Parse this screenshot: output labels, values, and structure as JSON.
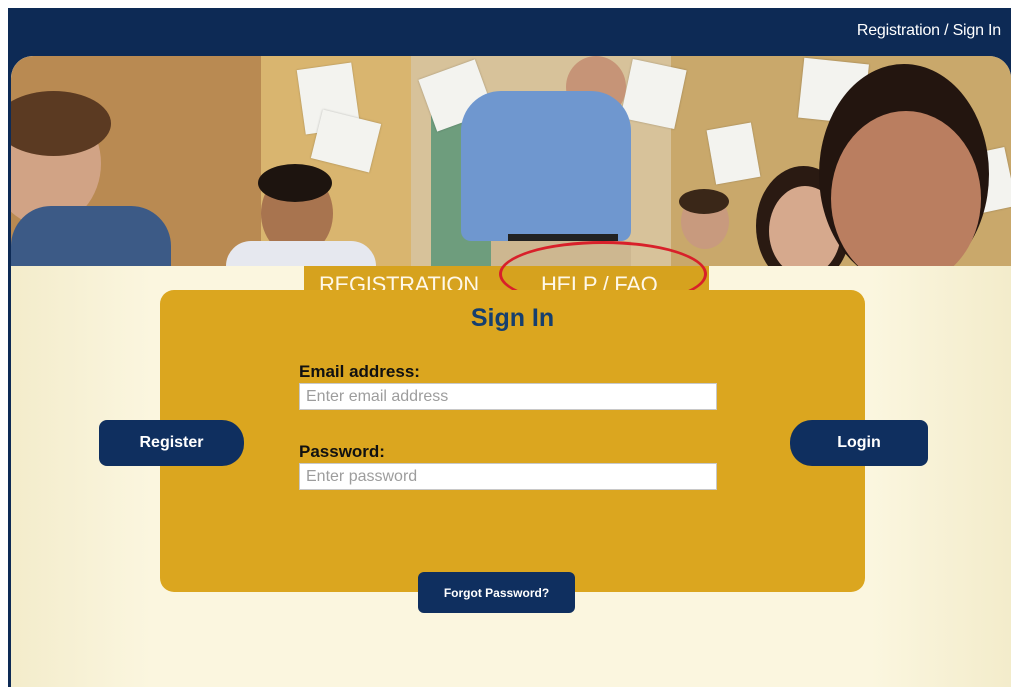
{
  "header": {
    "nav_link": "Registration / Sign In"
  },
  "tabs": [
    {
      "label": "REGISTRATION"
    },
    {
      "label": "HELP / FAQ"
    }
  ],
  "signin": {
    "title": "Sign In",
    "email_label": "Email address:",
    "email_placeholder": "Enter email address",
    "password_label": "Password:",
    "password_placeholder": "Enter password"
  },
  "buttons": {
    "register": "Register",
    "login": "Login",
    "forgot": "Forgot Password?"
  },
  "colors": {
    "navy": "#0d2a55",
    "gold": "#dba61f",
    "cream": "#fbf6df",
    "highlight_red": "#d8202a"
  }
}
